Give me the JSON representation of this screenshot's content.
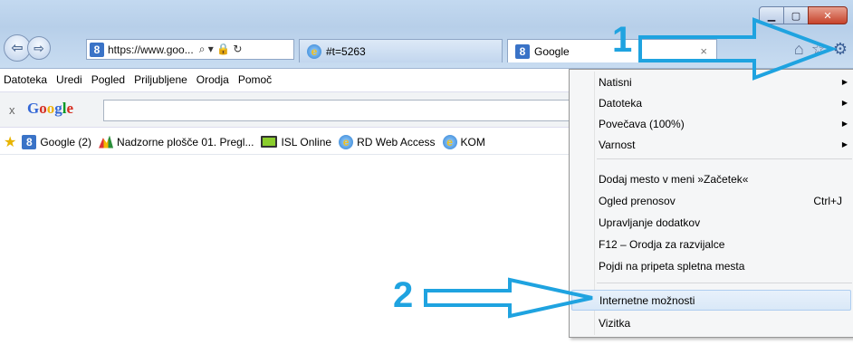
{
  "window": {
    "minimize_glyph": "▁",
    "maximize_glyph": "▢",
    "close_glyph": "✕"
  },
  "nav": {
    "back_glyph": "⇦",
    "forward_glyph": "⇨",
    "address": "https://www.goo...",
    "address_icons": "⌕ ▾ 🔒 ↻"
  },
  "tabs": [
    {
      "label": "#t=5263",
      "icon": "ie-icon"
    },
    {
      "label": "Google",
      "icon": "google-icon",
      "close": "×"
    }
  ],
  "tools": {
    "home_glyph": "⌂",
    "star_glyph": "☆",
    "gear_glyph": "⚙"
  },
  "menubar": [
    "Datoteka",
    "Uredi",
    "Pogled",
    "Priljubljene",
    "Orodja",
    "Pomoč"
  ],
  "google_toolbar": {
    "close": "x",
    "logo": [
      "G",
      "o",
      "o",
      "g",
      "l",
      "e"
    ]
  },
  "favorites": [
    {
      "label": "Google (2)",
      "icon": "google-icon"
    },
    {
      "label": "Nadzorne plošče 01. Pregl...",
      "icon": "chart-icon"
    },
    {
      "label": "ISL Online",
      "icon": "monitor-icon"
    },
    {
      "label": "RD Web Access",
      "icon": "ie-icon"
    },
    {
      "label": "KOM",
      "icon": "ie-icon"
    }
  ],
  "menu": {
    "group1": [
      {
        "label": "Natisni",
        "submenu": true
      },
      {
        "label": "Datoteka",
        "submenu": true
      },
      {
        "label": "Povečava (100%)",
        "submenu": true
      },
      {
        "label": "Varnost",
        "submenu": true
      }
    ],
    "group2": [
      {
        "label": "Dodaj mesto v meni »Začetek«"
      },
      {
        "label": "Ogled prenosov",
        "shortcut": "Ctrl+J"
      },
      {
        "label": "Upravljanje dodatkov"
      },
      {
        "label": "F12 – Orodja za razvijalce"
      },
      {
        "label": "Pojdi na pripeta spletna mesta"
      }
    ],
    "group3": [
      {
        "label": "Internetne možnosti",
        "highlighted": true
      },
      {
        "label": "Vizitka"
      }
    ],
    "submenu_arrow": "▶"
  },
  "annotations": {
    "step1": "1",
    "step2": "2",
    "color": "#1fa3e0"
  }
}
